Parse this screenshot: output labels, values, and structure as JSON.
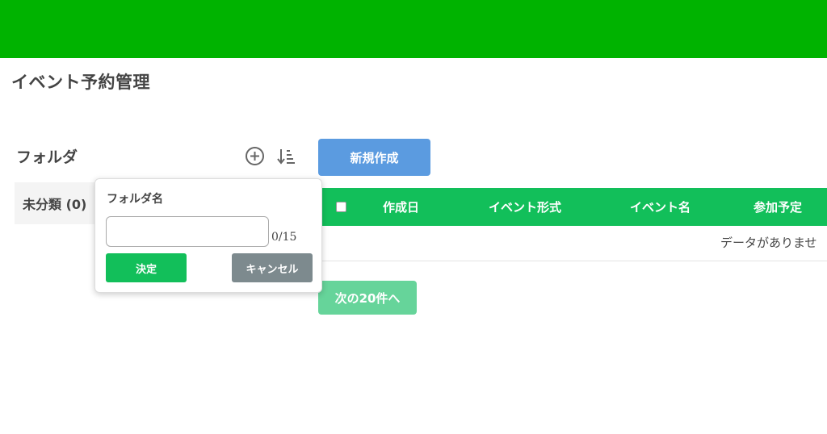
{
  "header": {
    "color": "#00b300"
  },
  "page": {
    "title": "イベント予約管理"
  },
  "folders": {
    "heading": "フォルダ",
    "add_icon": "circle-plus-icon",
    "sort_icon": "sort-icon",
    "items": [
      {
        "label": "未分類 (0)"
      }
    ]
  },
  "toolbar": {
    "new_label": "新規作成",
    "new_color": "#5b9be0"
  },
  "table": {
    "accent": "#12bf5a",
    "columns": [
      "作成日",
      "イベント形式",
      "イベント名",
      "参加予定"
    ],
    "empty_text": "データがありませ"
  },
  "pagination": {
    "next_label": "次の20件へ"
  },
  "popover": {
    "label": "フォルダ名",
    "input_value": "",
    "counter": "0/15",
    "ok_label": "決定",
    "cancel_label": "キャンセル"
  }
}
